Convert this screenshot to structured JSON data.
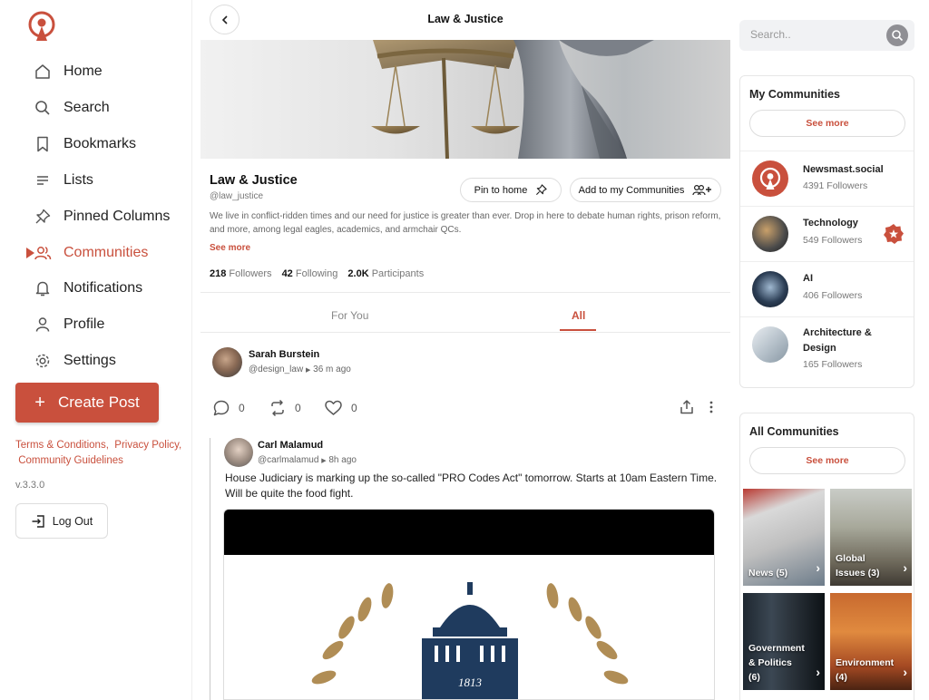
{
  "sidebar": {
    "nav": [
      {
        "label": "Home",
        "icon": "home-icon"
      },
      {
        "label": "Search",
        "icon": "search-icon"
      },
      {
        "label": "Bookmarks",
        "icon": "bookmark-icon"
      },
      {
        "label": "Lists",
        "icon": "list-icon"
      },
      {
        "label": "Pinned Columns",
        "icon": "pin-icon"
      },
      {
        "label": "Communities",
        "icon": "communities-icon",
        "active": true
      },
      {
        "label": "Notifications",
        "icon": "bell-icon"
      },
      {
        "label": "Profile",
        "icon": "profile-icon"
      },
      {
        "label": "Settings",
        "icon": "gear-icon"
      }
    ],
    "create_post": "Create Post",
    "footer": {
      "terms": "Terms & Conditions,",
      "privacy": "Privacy Policy,",
      "guidelines": "Community Guidelines"
    },
    "version": "v.3.3.0",
    "logout": "Log Out"
  },
  "main": {
    "title": "Law & Justice",
    "community": {
      "name": "Law & Justice",
      "handle": "@law_justice",
      "pin_button": "Pin to home",
      "add_button": "Add to my Communities",
      "description": "We live in conflict-ridden times and our need for justice is greater than ever. Drop in here to debate human rights, prison reform, and more, among legal eagles, academics, and armchair QCs.",
      "see_more": "See more",
      "stats": {
        "followers_count": "218",
        "followers_label": "Followers",
        "following_count": "42",
        "following_label": "Following",
        "participants_count": "2.0K",
        "participants_label": "Participants"
      }
    },
    "tabs": [
      {
        "label": "For You"
      },
      {
        "label": "All",
        "active": true
      }
    ],
    "post": {
      "author": "Sarah Burstein",
      "handle": "@design_law",
      "time": "36 m ago",
      "replies": "0",
      "boosts": "0",
      "likes": "0"
    },
    "reply": {
      "author": "Carl Malamud",
      "handle": "@carlmalamud",
      "time": "8h ago",
      "text": "House Judiciary is marking up the so-called \"PRO Codes Act\" tomorrow. Starts at 10am Eastern Time. Will be quite the food fight.",
      "seal_year": "1813"
    }
  },
  "right": {
    "search": {
      "placeholder": "Search.."
    },
    "my_communities": {
      "title": "My Communities",
      "see_more": "See more",
      "items": [
        {
          "name": "Newsmast.social",
          "count": "4391",
          "label": "Followers"
        },
        {
          "name": "Technology",
          "count": "549",
          "label": "Followers"
        },
        {
          "name": "AI",
          "count": "406",
          "label": "Followers"
        },
        {
          "name": "Architecture &",
          "name2": "Design",
          "count": "165",
          "label": "Followers"
        }
      ]
    },
    "all_communities": {
      "title": "All Communities",
      "see_more": "See more",
      "tiles": [
        {
          "line1": "News (5)",
          "line2": "",
          "line3": ""
        },
        {
          "line1": "Global",
          "line2": "Issues (3)",
          "line3": ""
        },
        {
          "line1": "Government",
          "line2": "& Politics",
          "line3": "(6)"
        },
        {
          "line1": "Environment",
          "line2": "(4)",
          "line3": ""
        }
      ]
    }
  },
  "colors": {
    "accent": "#c9503d",
    "text": "#111111",
    "muted": "#777777"
  }
}
